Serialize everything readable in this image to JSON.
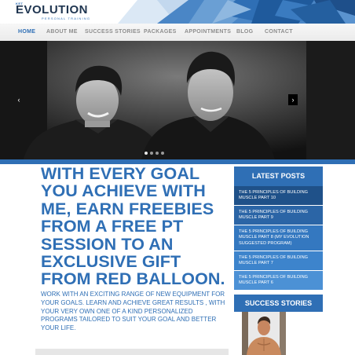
{
  "brand": {
    "tagline_small": "KET",
    "name": "EVOLUTION",
    "subtitle": "PERSONAL TRAINING"
  },
  "nav": {
    "items": [
      {
        "label": "HOME",
        "active": true
      },
      {
        "label": "ABOUT ME",
        "active": false
      },
      {
        "label": "SUCCESS STORIES",
        "active": false
      },
      {
        "label": "PACKAGES",
        "active": false
      },
      {
        "label": "APPOINTMENTS",
        "active": false
      },
      {
        "label": "BLOG",
        "active": false
      },
      {
        "label": "CONTACT",
        "active": false
      }
    ]
  },
  "slider": {
    "prev_icon": "chevron-left",
    "next_icon": "chevron-right",
    "slide_count": 4,
    "active_slide": 1
  },
  "main": {
    "headline": "WITH EVERY GOAL YOU ACHIEVE WITH ME, EARN FREEBIES FROM A FREE PT SESSION TO AN EXCLUSIVE GIFT FROM RED BALLOON.",
    "body": "WORK WITH AN EXCITING RANGE OF NEW EQUIPMENT FOR YOUR GOALS. LEARN AND ACHIEVE GREAT RESULTS , WITH YOUR VERY OWN ONE OF A KIND PERSONALIZED PROGRAMS TAILORED TO SUIT YOUR GOAL AND BETTER YOUR LIFE."
  },
  "sidebar": {
    "latest_posts_title": "LATEST POSTS",
    "posts": [
      "THE 5 PRINCIPLES OF BUILDING MUSCLE PART 10",
      "THE 5 PRINCIPLES OF BUILDING MUSCLE PART 9",
      "THE 5 PRINCIPLES OF BUILDING MUSCLE PART 8 (MY EVOLUTION SUGGESTED PROGRAM)",
      "THE 5 PRINCIPLES OF BUILDING MUSCLE PART 7",
      "THE 5 PRINCIPLES OF BUILDING MUSCLE PART 6"
    ],
    "success_title": "SUCCESS STORIES"
  },
  "colors": {
    "brand_blue": "#2f6fb5",
    "dark_navy": "#1f3550",
    "nav_grey": "#8d8d8d"
  }
}
